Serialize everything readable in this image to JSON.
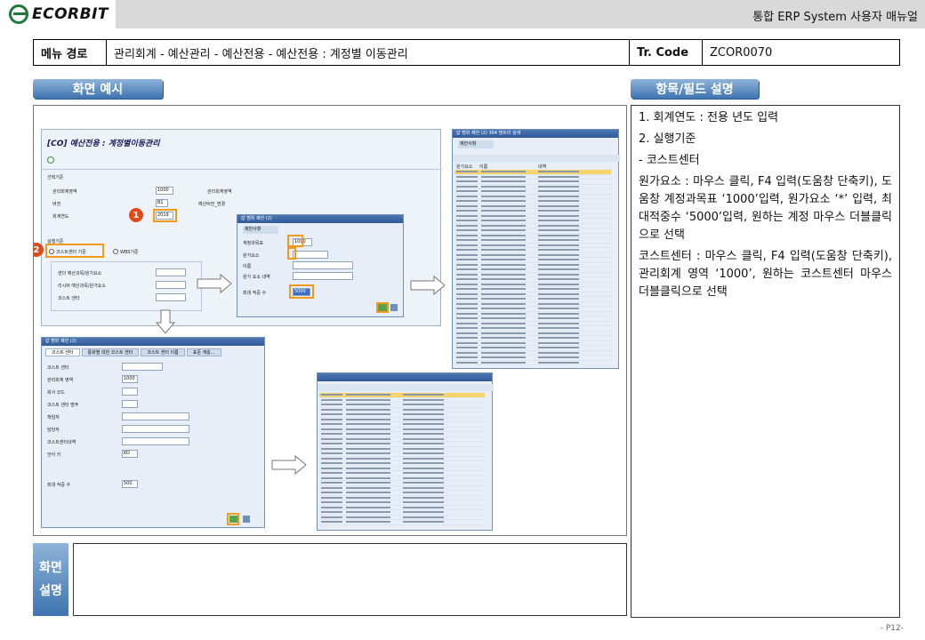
{
  "header": {
    "logo_text": "ECORBIT",
    "manual_title": "통합 ERP System 사용자 매뉴얼"
  },
  "menu": {
    "path_label": "메뉴 경로",
    "path_value": "관리회계 - 예산관리 - 예산전용 - 예산전용 : 계정별 이동관리",
    "tr_label": "Tr. Code",
    "tr_value": "ZCOR0070"
  },
  "sections": {
    "screen_example": "화면 예시",
    "field_desc": "항목/필드 설명",
    "screen_desc_line1": "화면",
    "screen_desc_line2": "설명"
  },
  "field_desc": {
    "item1": "1.  회계연도 : 전용 년도 입력",
    "item2": "2.  실행기준",
    "item2_sub": " - 코스트센터",
    "para1": "원가요소 : 마우스 클릭, F4 입력(도움창 단축키), 도움창 계정과목표 ‘1000’입력, 원가요소 ‘*’ 입력, 최대적중수 ‘5000’입력, 원하는 계정 마우스 더블클릭으로 선택",
    "para2": "코스트센터 : 마우스 클릭, F4 입력(도움창 단축키), 관리회계 영역 ‘1000’, 원하는 코스트센터 마우스 더블클릭으로 선택"
  },
  "screenshot": {
    "sap_title": "[CO] 예산전용 : 계정별이동관리",
    "selection_header": "선택기준",
    "f_controlling_area": "관리회계영역",
    "f_controlling_area_value": "1000",
    "f_controlling_area_right": "관리회계영역",
    "f_version": "버전",
    "f_version_value": "B1",
    "f_version_right": "예산버전_변경",
    "f_year": "회계연도",
    "f_year_value": "2019",
    "exec_header": "실행기준",
    "radio_cc": "코스트센터 기준",
    "radio_wbs": "WBS기준",
    "row1": "센더 예산과목/원가요소",
    "row2": "리시버 예산과목/원가요소",
    "row3": "코스트 센터",
    "badge1": "1",
    "badge2": "2",
    "popup1_title": "값 범위 제한 (2)",
    "popup1_tab": "제한사항",
    "popup1_f1": "계정과목표",
    "popup1_f1_value": "1000",
    "popup1_f2": "원가요소",
    "popup1_f2_value": "*",
    "popup1_f3": "이름",
    "popup1_f4": "원가 요소 내역",
    "popup1_f5": "최대 적중 수",
    "popup1_f5_value": "5000",
    "list1_title": "값 범위 제한 (2) 364 엔트리 검색",
    "list1_tab": "제한사항",
    "list1_col1": "원가요소",
    "list1_col2": "이름",
    "list1_col3": "내역",
    "popup2_title": "값 범위 제한 (2)",
    "popup2_tabs": [
      "코스트 센터",
      "통화별 대한 코스트 센터",
      "코스트 센터 이름",
      "표준 계층..."
    ],
    "popup2_fields": [
      "코스트 센터",
      "관리회계 영역",
      "회사 코드",
      "코스트 센터 범주",
      "책임자",
      "담당자",
      "코스트센터내역",
      "언어 키",
      "최대 적중 수"
    ],
    "popup2_area_value": "1000",
    "popup2_lang_value": "KO",
    "popup2_max_value": "500"
  },
  "page": {
    "number": "- P12-"
  }
}
